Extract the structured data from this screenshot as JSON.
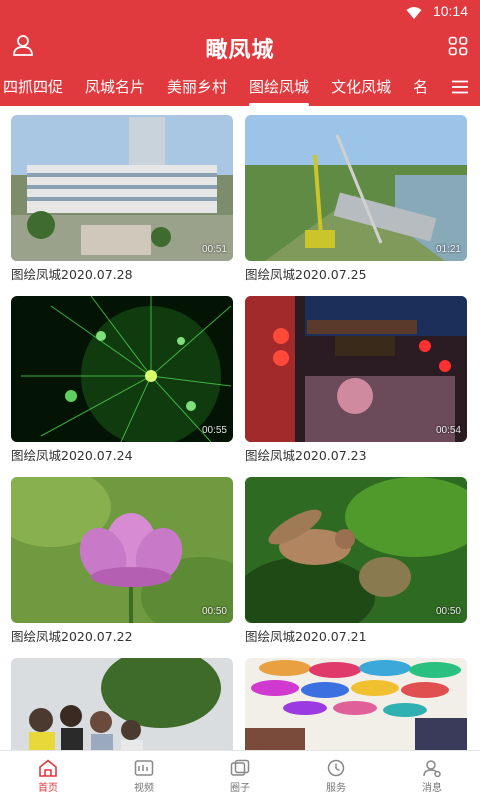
{
  "status": {
    "time": "10:14",
    "wifi_icon": "wifi-icon"
  },
  "header": {
    "title": "瞰凤城",
    "user_icon": "user-icon",
    "grid_icon": "grid-icon",
    "bg": "#e0393e"
  },
  "tabs": [
    {
      "label": "四抓四促"
    },
    {
      "label": "凤城名片"
    },
    {
      "label": "美丽乡村"
    },
    {
      "label": "图绘凤城",
      "active": true
    },
    {
      "label": "文化凤城"
    },
    {
      "label": "名"
    }
  ],
  "videos": [
    {
      "caption": "图绘凤城2020.07.28",
      "duration": "00:51"
    },
    {
      "caption": "图绘凤城2020.07.25",
      "duration": "01:21"
    },
    {
      "caption": "图绘凤城2020.07.24",
      "duration": "00:55"
    },
    {
      "caption": "图绘凤城2020.07.23",
      "duration": "00:54"
    },
    {
      "caption": "图绘凤城2020.07.22",
      "duration": "00:50"
    },
    {
      "caption": "图绘凤城2020.07.21",
      "duration": "00:50"
    },
    {
      "caption": "",
      "duration": ""
    },
    {
      "caption": "",
      "duration": ""
    }
  ],
  "bottom_nav": [
    {
      "label": "首页",
      "icon": "home-icon",
      "active": true
    },
    {
      "label": "视频",
      "icon": "video-icon"
    },
    {
      "label": "圈子",
      "icon": "circle-icon"
    },
    {
      "label": "服务",
      "icon": "service-icon"
    },
    {
      "label": "消息",
      "icon": "message-icon"
    }
  ]
}
